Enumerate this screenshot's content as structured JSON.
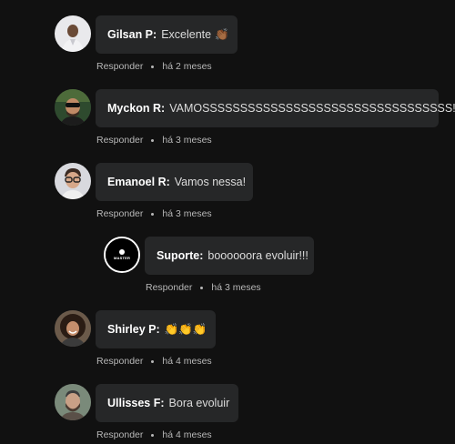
{
  "reply_label": "Responder",
  "comments": [
    {
      "author": "Gilsan P:",
      "text": "Excelente",
      "emoji": "👏🏾",
      "time": "há 2 meses",
      "avatar_icon": "person-photo-light-shirt"
    },
    {
      "author": "Myckon R:",
      "text": "VAMOSSSSSSSSSSSSSSSSSSSSSSSSSSSSSSSSS!!!",
      "emoji": "",
      "time": "há 3 meses",
      "avatar_icon": "person-photo-sunglasses"
    },
    {
      "author": "Emanoel R:",
      "text": "Vamos nessa!",
      "emoji": "",
      "time": "há 3 meses",
      "avatar_icon": "person-photo-glasses"
    },
    {
      "author": "Suporte:",
      "text": "boooooora evoluir!!!",
      "emoji": "",
      "time": "há 3 meses",
      "avatar_icon": "brand-logo-avatar",
      "logo_text": "MASTER"
    },
    {
      "author": "Shirley P:",
      "text": "",
      "emoji": "👏👏👏",
      "time": "há 4 meses",
      "avatar_icon": "person-photo-curly-hair"
    },
    {
      "author": "Ullisses F:",
      "text": "Bora evoluir",
      "emoji": "",
      "time": "há 4 meses",
      "avatar_icon": "person-photo-beard"
    }
  ]
}
